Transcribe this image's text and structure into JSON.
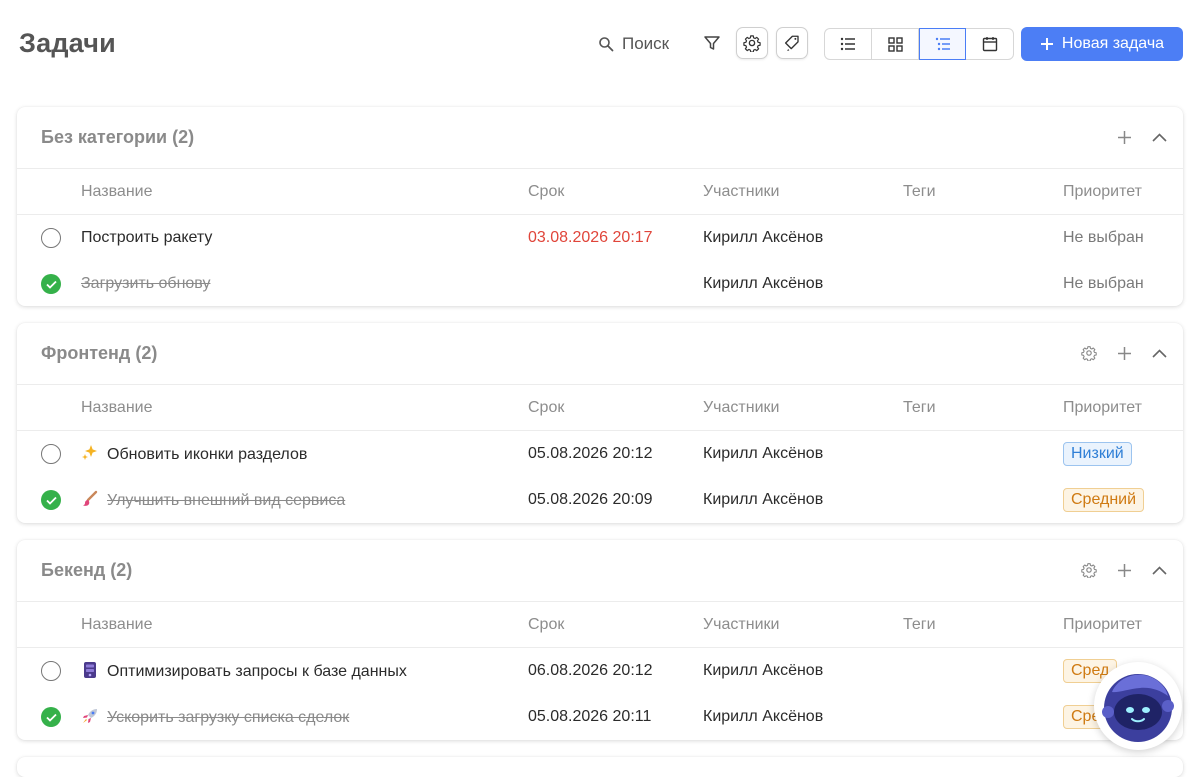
{
  "header": {
    "title": "Задачи",
    "search_label": "Поиск",
    "new_task_label": "Новая задача"
  },
  "columns": {
    "name": "Название",
    "date": "Срок",
    "users": "Участники",
    "tags": "Теги",
    "priority": "Приоритет"
  },
  "groups": [
    {
      "title": "Без категории (2)",
      "tasks": [
        {
          "name": "Построить ракету",
          "date": "03.08.2026 20:17",
          "user": "Кирилл Аксёнов",
          "priority": "Не выбран",
          "done": false,
          "overdue": true
        },
        {
          "name": "Загрузить обнову",
          "date": "",
          "user": "Кирилл Аксёнов",
          "priority": "Не выбран",
          "done": true
        }
      ]
    },
    {
      "title": "Фронтенд (2)",
      "tasks": [
        {
          "emoji": "sparkles-icon",
          "name": "Обновить иконки разделов",
          "date": "05.08.2026 20:12",
          "user": "Кирилл Аксёнов",
          "priority": "Низкий",
          "done": false
        },
        {
          "emoji": "paintbrush-icon",
          "name": "Улучшить внешний вид сервиса",
          "date": "05.08.2026 20:09",
          "user": "Кирилл Аксёнов",
          "priority": "Средний",
          "done": true
        }
      ]
    },
    {
      "title": "Бекенд (2)",
      "tasks": [
        {
          "emoji": "database-icon",
          "name": "Оптимизировать запросы к базе данных",
          "date": "06.08.2026 20:12",
          "user": "Кирилл Аксёнов",
          "priority": "Сред",
          "done": false
        },
        {
          "emoji": "rocket-icon",
          "name": "Ускорить загрузку списка сделок",
          "date": "05.08.2026 20:11",
          "user": "Кирилл Аксёнов",
          "priority": "Сре",
          "done": true
        }
      ]
    }
  ],
  "colors": {
    "accent": "#4c7ef5",
    "done_green": "#35b14a",
    "overdue_red": "#e0453a",
    "low_blue": "#2f7fd6",
    "mid_orange": "#cf7a12"
  }
}
